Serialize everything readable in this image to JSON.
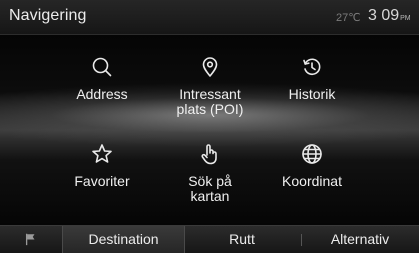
{
  "header": {
    "title": "Navigering",
    "temperature": "27℃",
    "time": "3 09",
    "ampm": "PM"
  },
  "menu": {
    "items": [
      {
        "label": "Address",
        "icon": "search-icon"
      },
      {
        "label": "Intressant\nplats (POI)",
        "icon": "location-pin-icon"
      },
      {
        "label": "Historik",
        "icon": "history-icon"
      },
      {
        "label": "Favoriter",
        "icon": "star-icon"
      },
      {
        "label": "Sök på\nkartan",
        "icon": "hand-pointer-icon"
      },
      {
        "label": "Koordinat",
        "icon": "globe-icon"
      }
    ]
  },
  "tabs": {
    "items": [
      {
        "label": "",
        "icon": "flag-icon",
        "active": false
      },
      {
        "label": "Destination",
        "active": true
      },
      {
        "label": "Rutt",
        "active": false
      },
      {
        "label": "Alternativ",
        "active": false
      }
    ]
  },
  "colors": {
    "text": "#f0f0f0",
    "header_background": "#1e1e1e",
    "active_tab": "#333333"
  }
}
